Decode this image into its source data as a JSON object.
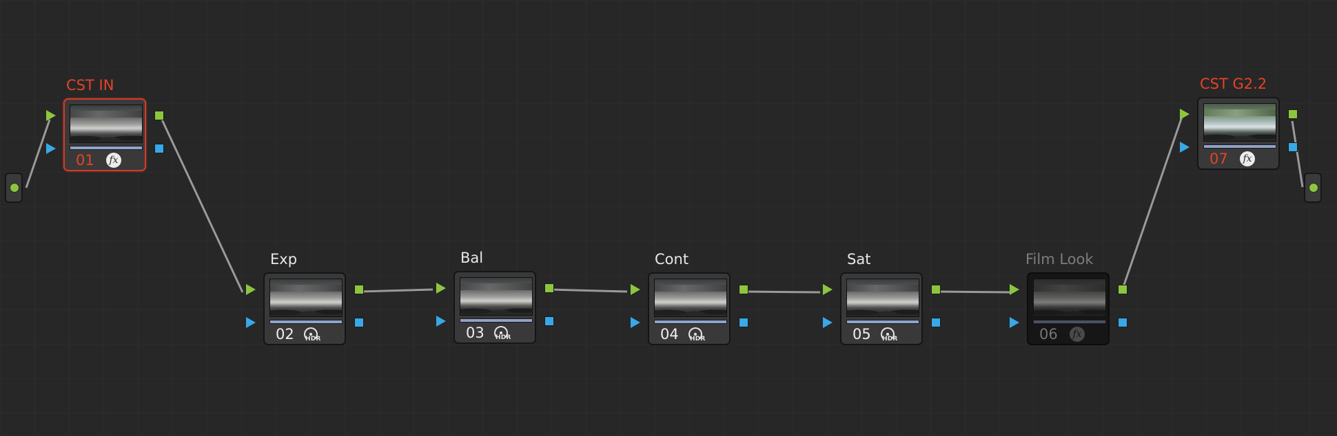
{
  "canvas": {
    "name": "Node Editor"
  },
  "colors": {
    "background": "#272727",
    "grid": "#2c2c2c",
    "node_fill": "#393939",
    "rgb_port": "#8cc63f",
    "key_port": "#38a8e8",
    "cst_accent": "#e4432a",
    "disabled_text": "#7d7d7d",
    "wire": "#9a9a9a"
  },
  "input_terminal": {
    "icon": "source-input-dot"
  },
  "output_terminal": {
    "icon": "output-dot"
  },
  "nodes": [
    {
      "id": "01",
      "label": "CST IN",
      "number": "01",
      "icon": "fx-icon",
      "state": "cst"
    },
    {
      "id": "02",
      "label": "Exp",
      "number": "02",
      "icon": "hdr-icon",
      "state": "normal"
    },
    {
      "id": "03",
      "label": "Bal",
      "number": "03",
      "icon": "hdr-icon",
      "state": "normal"
    },
    {
      "id": "04",
      "label": "Cont",
      "number": "04",
      "icon": "hdr-icon",
      "state": "normal"
    },
    {
      "id": "05",
      "label": "Sat",
      "number": "05",
      "icon": "hdr-icon",
      "state": "normal"
    },
    {
      "id": "06",
      "label": "Film Look",
      "number": "06",
      "icon": "fx-icon",
      "state": "disabled"
    },
    {
      "id": "07",
      "label": "CST G2.2",
      "number": "07",
      "icon": "fx-icon",
      "state": "cst"
    }
  ],
  "hdr_badge_text": "HDR",
  "fx_badge_text": "fx",
  "connections": [
    [
      "input",
      "01"
    ],
    [
      "01",
      "02"
    ],
    [
      "02",
      "03"
    ],
    [
      "03",
      "04"
    ],
    [
      "04",
      "05"
    ],
    [
      "05",
      "06"
    ],
    [
      "06",
      "07"
    ],
    [
      "07",
      "output"
    ]
  ]
}
